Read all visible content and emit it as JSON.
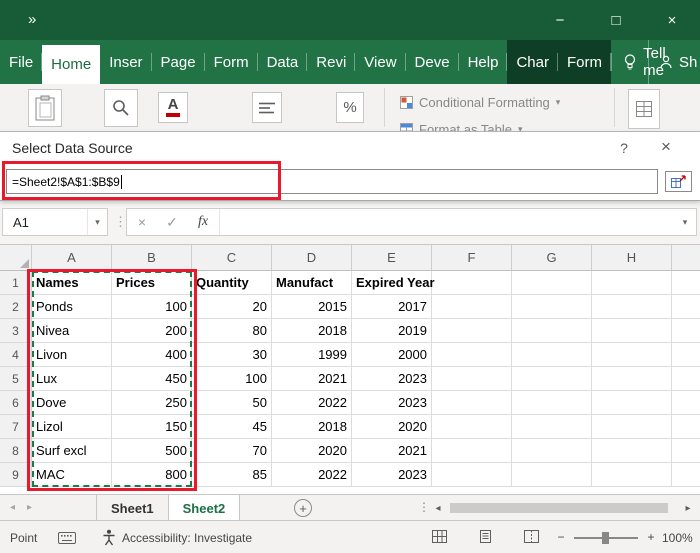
{
  "window": {
    "title_chevron": "»",
    "controls": {
      "minimize": "−",
      "maximize": "□",
      "close": "×"
    }
  },
  "ribbon": {
    "tabs": [
      {
        "label": "File"
      },
      {
        "label": "Home",
        "state": "active"
      },
      {
        "label": "Inser"
      },
      {
        "label": "Page"
      },
      {
        "label": "Form"
      },
      {
        "label": "Data"
      },
      {
        "label": "Revi"
      },
      {
        "label": "View"
      },
      {
        "label": "Deve"
      },
      {
        "label": "Help"
      },
      {
        "label": "Char",
        "state": "contextual"
      },
      {
        "label": "Form",
        "state": "contextual"
      }
    ],
    "tell_me": "Tell me",
    "share": "Sh",
    "groups": {
      "conditional_formatting": "Conditional Formatting",
      "format_as_table": "Format as Table"
    },
    "dropdown_glyph": "▾"
  },
  "dialog": {
    "title": "Select Data Source",
    "help_glyph": "?",
    "close_glyph": "×",
    "range_input": "=Sheet2!$A$1:$B$9"
  },
  "formula_bar": {
    "name_box": "A1",
    "dots_glyph": "⋮",
    "cancel_glyph": "×",
    "enter_glyph": "✓",
    "fx_label": "fx",
    "dropdown_glyph": "▾"
  },
  "grid": {
    "columns": [
      "A",
      "B",
      "C",
      "D",
      "E",
      "F",
      "G",
      "H"
    ],
    "rows": [
      {
        "n": 1,
        "bold": true,
        "cells": [
          "Names",
          "Prices",
          "Quantity",
          "Manufact",
          "Expired Year"
        ]
      },
      {
        "n": 2,
        "cells": [
          "Ponds",
          "100",
          "20",
          "2015",
          "2017"
        ]
      },
      {
        "n": 3,
        "cells": [
          "Nivea",
          "200",
          "80",
          "2018",
          "2019"
        ]
      },
      {
        "n": 4,
        "cells": [
          "Livon",
          "400",
          "30",
          "1999",
          "2000"
        ]
      },
      {
        "n": 5,
        "cells": [
          "Lux",
          "450",
          "100",
          "2021",
          "2023"
        ]
      },
      {
        "n": 6,
        "cells": [
          "Dove",
          "250",
          "50",
          "2022",
          "2023"
        ]
      },
      {
        "n": 7,
        "cells": [
          "Lizol",
          "150",
          "45",
          "2018",
          "2020"
        ]
      },
      {
        "n": 8,
        "cells": [
          "Surf excl",
          "500",
          "70",
          "2020",
          "2021"
        ]
      },
      {
        "n": 9,
        "cells": [
          "MAC",
          "800",
          "85",
          "2022",
          "2023"
        ]
      }
    ],
    "selected_range": "A1:B9"
  },
  "sheets": {
    "nav_left": "◂",
    "nav_right": "▸",
    "tabs": [
      "Sheet1",
      "Sheet2"
    ],
    "active": "Sheet2",
    "add_glyph": "+",
    "dots_glyph": "⋮",
    "scroll_left": "◂",
    "scroll_right": "▸"
  },
  "status": {
    "mode": "Point",
    "accessibility_label": "Accessibility: Investigate",
    "zoom_out": "−",
    "zoom_in": "+",
    "zoom_level": "100%"
  },
  "colors": {
    "titlebar_green": "#185c37",
    "ribbon_green": "#217346",
    "contextual_tab_green": "#0e3f26",
    "annotation_red": "#e8192c",
    "selection_dash_green": "#1f7a46",
    "active_sheet_text": "#1e7145"
  }
}
